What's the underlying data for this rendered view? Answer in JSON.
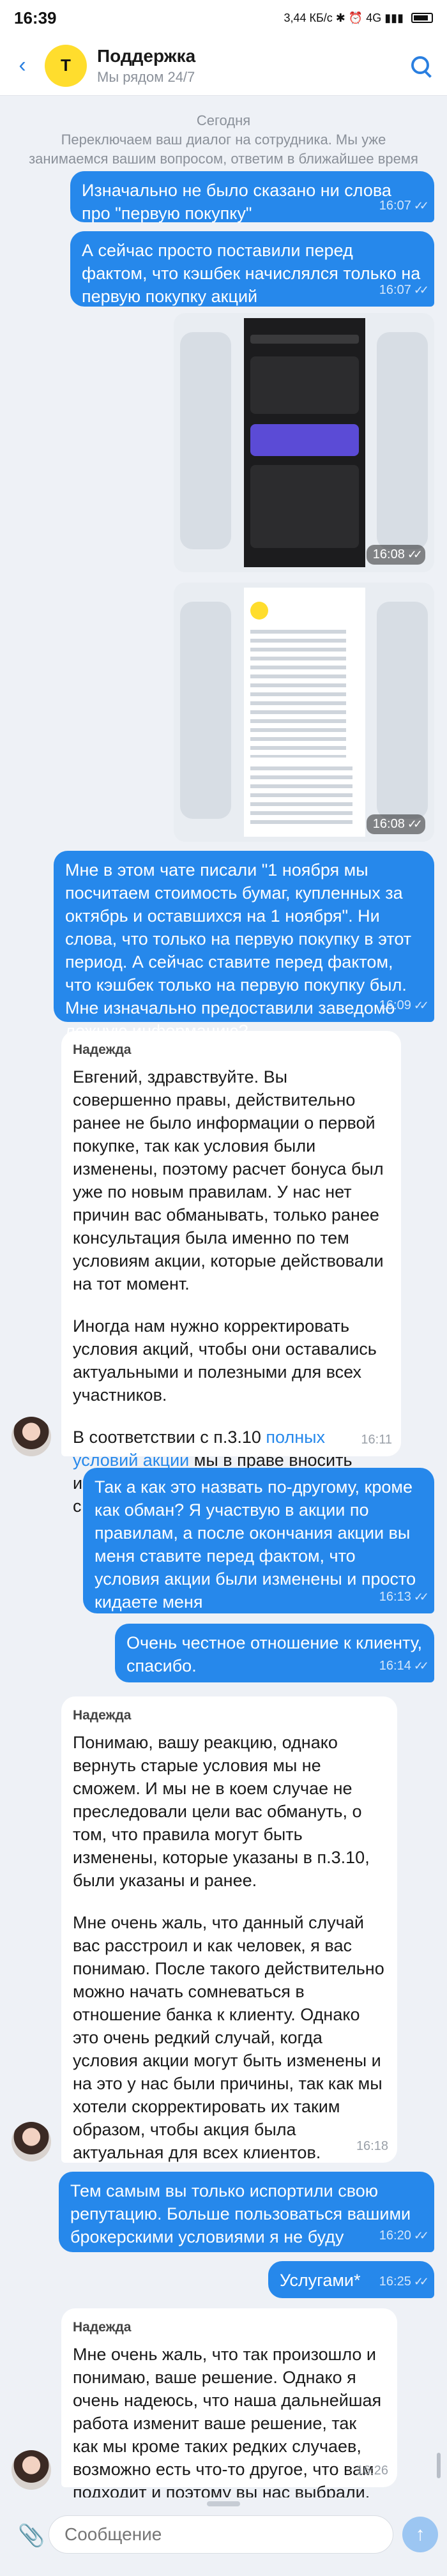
{
  "status_bar": {
    "time": "16:39",
    "indicators": "3,44 КБ/с  ✱  ⏰  4G  ▮▮▮"
  },
  "header": {
    "back_icon": "arrow-left-icon",
    "title": "Поддержка",
    "subtitle": "Мы рядом 24/7",
    "logo_text": "Т"
  },
  "day_separator": "Сегодня",
  "system_message": "Переключаем ваш диалог на сотрудника. Мы уже занимаемся вашим вопросом, ответим в ближайшее время",
  "messages": [
    {
      "id": "m1",
      "dir": "out",
      "text": "Изначально не было сказано ни слова про \"первую покупку\"",
      "time": "16:07"
    },
    {
      "id": "m2",
      "dir": "out",
      "text": "А сейчас просто поставили перед фактом, что кэшбек начислялся только на первую покупку акций",
      "time": "16:07"
    },
    {
      "id": "img1",
      "dir": "out",
      "type": "image",
      "time": "16:08"
    },
    {
      "id": "img2",
      "dir": "out",
      "type": "image",
      "time": "16:08"
    },
    {
      "id": "m3",
      "dir": "out",
      "text": "Мне в этом чате писали \"1 ноября мы посчитаем стоимость бумаг, купленных за октябрь и оставшихся на 1 ноября\". Ни слова, что только на первую покупку в этот период. А сейчас ставите перед фактом, что кэшбек только на первую покупку был. Мне изначально предоставили заведомо ложную информацию?",
      "time": "16:09"
    },
    {
      "id": "m4",
      "dir": "in",
      "sender": "Надежда",
      "p1": "Евгений, здравствуйте. Вы совершенно правы, действительно ранее не было информации о первой покупке, так как условия были изменены, поэтому расчет бонуса был уже по новым правилам. У нас нет причин вас обманывать, только ранее консультация была именно по тем условиям акции, которые действовали на тот момент.",
      "p2": "Иногда нам нужно корректировать условия акций, чтобы они оставались актуальными и полезными для всех участников.",
      "p3_before": "В соответствии с п.3.10 ",
      "p3_link": "полных условий акции",
      "p3_after": " мы в праве вносить изменения по акции. Это и произошло с категорией кешбэка.",
      "time": "16:11"
    },
    {
      "id": "m5",
      "dir": "out",
      "text": "Так а как это назвать по-другому, кроме как обман? Я участвую в акции по правилам, а после окончания акции вы меня ставите перед фактом, что условия акции были изменены и просто кидаете меня",
      "time": "16:13"
    },
    {
      "id": "m6",
      "dir": "out",
      "text": "Очень честное отношение к клиенту, спасибо.",
      "time": "16:14"
    },
    {
      "id": "m7",
      "dir": "in",
      "sender": "Надежда",
      "p1": "Понимаю, вашу реакцию, однако вернуть старые условия мы не сможем. И мы не в коем случае не преследовали цели вас обмануть, о том, что правила могут быть изменены, которые указаны в п.3.10, были указаны и ранее.",
      "p2": "Мне очень жаль, что данный случай вас расстроил и как человек, я вас понимаю. После такого действительно можно начать сомневаться в отношение банка к клиенту. Однако это очень редкий случай, когда условия акции могут быть изменены и на это у нас были причины, так как мы хотели скорректировать их таким образом, чтобы акция была актуальная для всех клиентов.",
      "time": "16:18"
    },
    {
      "id": "m8",
      "dir": "out",
      "text": "Тем самым вы только испортили свою репутацию. Больше пользоваться вашими брокерскими условиями я не буду",
      "time": "16:20"
    },
    {
      "id": "m9",
      "dir": "out",
      "text": "Услугами*",
      "time": "16:25"
    },
    {
      "id": "m10",
      "dir": "in",
      "sender": "Надежда",
      "p1": "Мне очень жаль, что так произошло и понимаю, ваше решение. Однако я очень надеюсь, что наша дальнейшая работа изменит ваше решение, так как мы кроме таких редких случаев, возможно есть что-то другое, что вам подходит и поэтому вы нас выбрали.",
      "time": "16:26"
    }
  ],
  "input": {
    "placeholder": "Сообщение",
    "attach_icon": "paperclip-icon",
    "send_icon": "send-arrow-icon"
  },
  "colors": {
    "outgoing": "#2688eb",
    "incoming": "#ffffff",
    "background": "#eef1f6",
    "brand": "#ffdd2d"
  }
}
